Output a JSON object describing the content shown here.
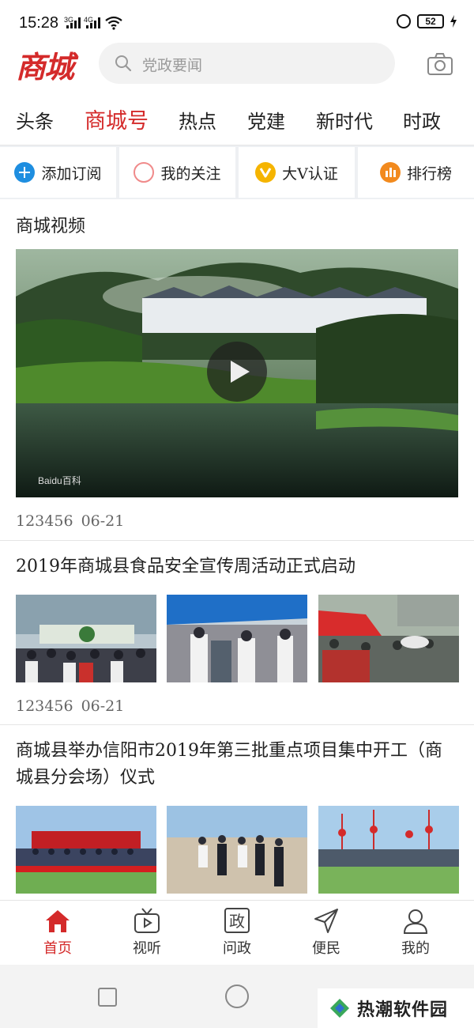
{
  "status_bar": {
    "time": "15:28",
    "signal_1": "3G",
    "signal_2": "4G",
    "battery": "52"
  },
  "header": {
    "logo": "商城",
    "search_placeholder": "党政要闻"
  },
  "tabs": [
    "头条",
    "商城号",
    "热点",
    "党建",
    "新时代",
    "时政"
  ],
  "active_tab": "商城号",
  "quick_actions": [
    {
      "label": "添加订阅",
      "icon": "plus-circle-icon",
      "color": "#1e8ee0"
    },
    {
      "label": "我的关注",
      "icon": "ring-icon",
      "color": "#f08a8a"
    },
    {
      "label": "大V认证",
      "icon": "v-badge-icon",
      "color": "#f5b400"
    },
    {
      "label": "排行榜",
      "icon": "bar-chart-icon",
      "color": "#f28a1e"
    }
  ],
  "video_section": {
    "title": "商城视频",
    "watermark": "Baidu百科",
    "meta": {
      "source": "123456",
      "date": "06-21"
    }
  },
  "articles": [
    {
      "title": "2019年商城县食品安全宣传周活动正式启动",
      "meta": {
        "source": "123456",
        "date": "06-21"
      }
    },
    {
      "title": "商城县举办信阳市2019年第三批重点项目集中开工（商城县分会场）仪式"
    }
  ],
  "bottom_nav": [
    {
      "label": "首页",
      "icon": "home-icon"
    },
    {
      "label": "视听",
      "icon": "tv-icon"
    },
    {
      "label": "问政",
      "icon": "question-gov-icon"
    },
    {
      "label": "便民",
      "icon": "send-icon"
    },
    {
      "label": "我的",
      "icon": "user-icon"
    }
  ],
  "nav_icon_glyph": "政",
  "watermark": "热潮软件园",
  "colors": {
    "accent": "#d42a2a",
    "divider": "#e5e5e5"
  }
}
